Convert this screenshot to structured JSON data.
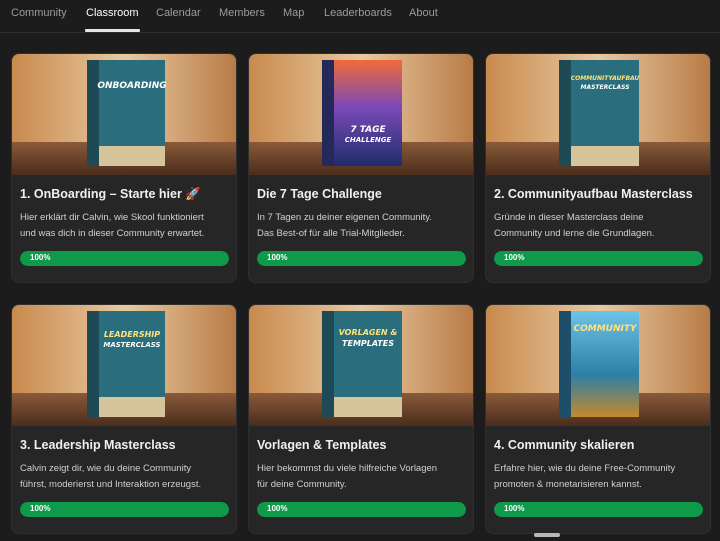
{
  "nav": {
    "tabs": [
      "Community",
      "Classroom",
      "Calendar",
      "Members",
      "Map",
      "Leaderboards",
      "About"
    ],
    "active": "Classroom"
  },
  "courses": [
    {
      "title": "1. OnBoarding – Starte hier 🚀",
      "desc_line1": "Hier erklärt dir Calvin, wie Skool funktioniert",
      "desc_line2": "und was dich in dieser Community erwartet.",
      "progress_label": "100%",
      "progress": 1.0,
      "box_line1": "ONBOARDING",
      "box_line2": "",
      "box_color": "#2a6e7d"
    },
    {
      "title": "Die 7 Tage Challenge",
      "desc_line1": "In 7 Tagen zu deiner eigenen Community.",
      "desc_line2": "Das Best-of für alle Trial-Mitglieder.",
      "progress_label": "100%",
      "progress": 1.0,
      "box_line1": "7 TAGE",
      "box_line2": "CHALLENGE",
      "box_color": "#3b3f86"
    },
    {
      "title": "2. Communityaufbau Masterclass",
      "desc_line1": "Gründe in dieser Masterclass deine",
      "desc_line2": "Community und lerne die Grundlagen.",
      "progress_label": "100%",
      "progress": 1.0,
      "box_line1": "COMMUNITYAUFBAU",
      "box_line2": "MASTERCLASS",
      "box_color": "#2a6e7d"
    },
    {
      "title": "3. Leadership Masterclass",
      "desc_line1": "Calvin zeigt dir, wie du deine Community",
      "desc_line2": "führst, moderierst und Interaktion erzeugst.",
      "progress_label": "100%",
      "progress": 1.0,
      "box_line1": "LEADERSHIP",
      "box_line2": "MASTERCLASS",
      "box_color": "#2a6e7d"
    },
    {
      "title": "Vorlagen & Templates",
      "desc_line1": "Hier bekommst du viele hilfreiche Vorlagen",
      "desc_line2": "für deine Community.",
      "progress_label": "100%",
      "progress": 1.0,
      "box_line1": "VORLAGEN &",
      "box_line2": "TEMPLATES",
      "box_color": "#2a6e7d"
    },
    {
      "title": "4. Community skalieren",
      "desc_line1": "Erfahre hier, wie du deine Free-Community",
      "desc_line2": "promoten & monetarisieren kannst.",
      "progress_label": "100%",
      "progress": 1.0,
      "box_line1": "COMMUNITY",
      "box_line2": "",
      "box_color": "#2d7fa8"
    }
  ]
}
